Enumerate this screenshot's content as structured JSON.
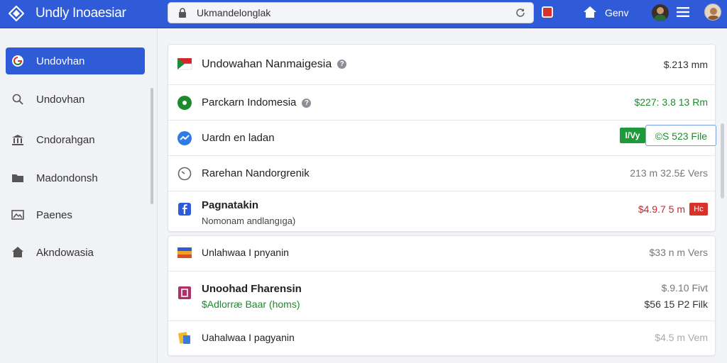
{
  "header": {
    "app_title": "Undly Inoaesiar",
    "search_value": "Ukmandelonglak",
    "action_label": "Genv"
  },
  "sidebar": {
    "items": [
      {
        "label": "Undovhan",
        "icon": "google-icon",
        "active": true
      },
      {
        "label": "Undovhan",
        "icon": "search-icon",
        "active": false
      },
      {
        "label": "Cndorahgan",
        "icon": "bank-icon",
        "active": false
      },
      {
        "label": "Madondonsh",
        "icon": "folder-icon",
        "active": false
      },
      {
        "label": "Paenes",
        "icon": "image-icon",
        "active": false
      },
      {
        "label": "Akndowasia",
        "icon": "home-icon",
        "active": false
      }
    ]
  },
  "card1": {
    "rows": [
      {
        "title": "Undowahan Nanmaigesia",
        "value": "$.213 mm",
        "icon": "flag-icon"
      },
      {
        "title": "Parckarn Indomesia",
        "value": "$227: 3.8 13 Rm",
        "icon": "green-circle-icon"
      },
      {
        "title": "Uardn en ladan",
        "pill": "I/Vy",
        "box_value": "©S 523 File",
        "icon": "messenger-icon"
      },
      {
        "title": "Rarehan Nandorgrenik",
        "value": "213 m 32.5£ Vers",
        "icon": "clock-icon"
      },
      {
        "title": "Pagnatakin",
        "subtitle": "Nomonam andlangıga)",
        "value": "$4.9.7 5 m",
        "badge": "Hc",
        "icon": "facebook-icon"
      }
    ]
  },
  "card2": {
    "rows": [
      {
        "title": "Unlahwaa I pnyanin",
        "value": "$33 n m Vers",
        "icon": "flag-stripes-icon"
      },
      {
        "title": "Unoohad Fharensin",
        "subtitle": "$Adlorræ Baar (homs)",
        "value": "$.9.10 Fivt",
        "value2": "$56 15 P2 Filk",
        "icon": "bookmark-icon"
      },
      {
        "title": "Uahalwaa I pagyanin",
        "value": "$4.5 m Vem",
        "icon": "gift-icon"
      }
    ]
  }
}
